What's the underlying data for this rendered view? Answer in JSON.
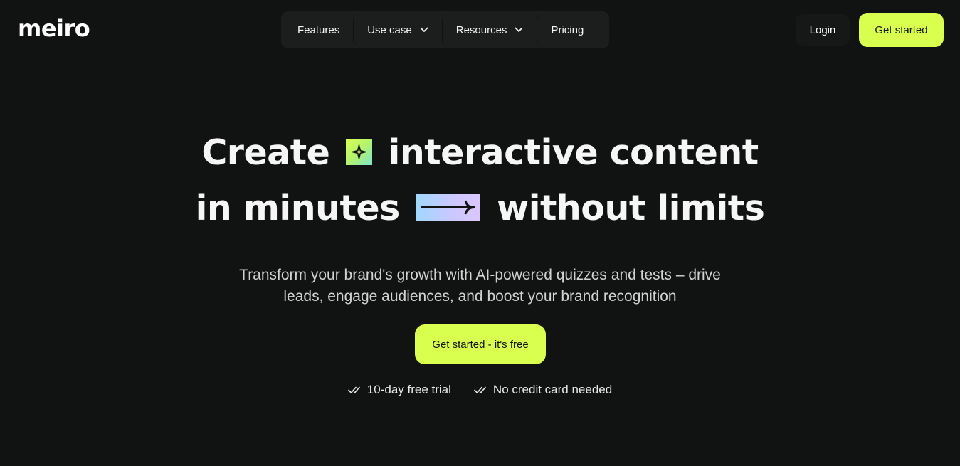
{
  "brand": {
    "name": "meiro",
    "accent_color": "#d9ff4f",
    "background_color": "#111212"
  },
  "nav": {
    "items": [
      {
        "label": "Features",
        "has_dropdown": false
      },
      {
        "label": "Use case",
        "has_dropdown": true,
        "icon": "chevron-down-icon"
      },
      {
        "label": "Resources",
        "has_dropdown": true,
        "icon": "chevron-down-icon"
      },
      {
        "label": "Pricing",
        "has_dropdown": false
      }
    ]
  },
  "header": {
    "login_label": "Login",
    "get_started_label": "Get started"
  },
  "hero": {
    "line1_before": "Create",
    "line1_icon": "sparkle-icon",
    "line1_after": "interactive content",
    "line2_before": "in minutes",
    "line2_icon": "arrow-right-icon",
    "line2_after": "without limits",
    "subtitle_line1": "Transform your brand's growth with AI-powered quizzes and tests – drive",
    "subtitle_line2": "leads, engage audiences, and boost your brand recognition",
    "cta_label": "Get started - it's free",
    "perks": [
      {
        "icon": "double-check-icon",
        "label": "10-day free trial"
      },
      {
        "icon": "double-check-icon",
        "label": "No credit card needed"
      }
    ]
  }
}
